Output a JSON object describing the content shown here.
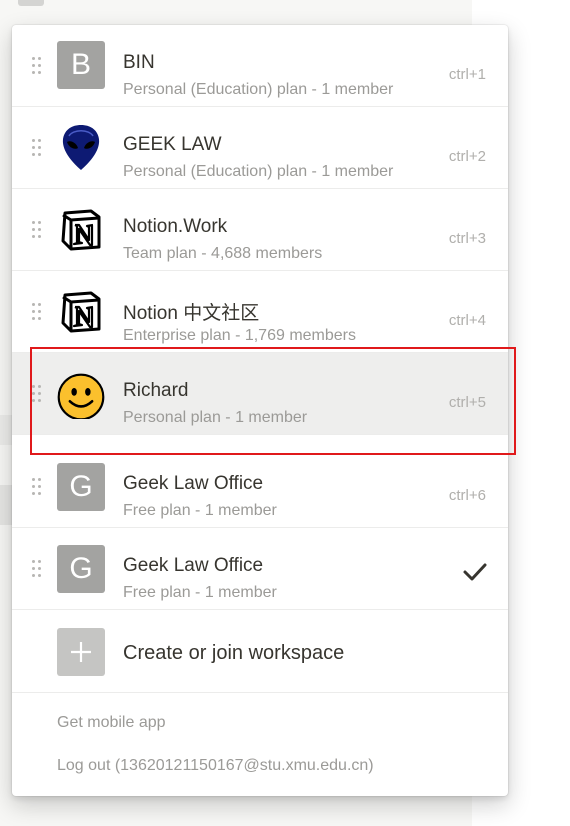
{
  "workspaces": [
    {
      "avatar_letter": "B",
      "avatar_icon": "letter-avatar",
      "name": "BIN",
      "plan": "Personal (Education) plan - 1 member",
      "shortcut": "ctrl+1"
    },
    {
      "avatar_letter": "",
      "avatar_icon": "alien-icon",
      "name": "GEEK LAW",
      "plan": "Personal (Education) plan - 1 member",
      "shortcut": "ctrl+2"
    },
    {
      "avatar_letter": "",
      "avatar_icon": "notion-logo-icon",
      "name": "Notion.Work",
      "plan": "Team plan - 4,688 members",
      "shortcut": "ctrl+3"
    },
    {
      "avatar_letter": "",
      "avatar_icon": "notion-logo-icon",
      "name": "Notion 中文社区",
      "plan": "Enterprise plan - 1,769 members",
      "shortcut": "ctrl+4"
    },
    {
      "avatar_letter": "",
      "avatar_icon": "smiley-face-icon",
      "name": "Richard",
      "plan": "Personal plan - 1 member",
      "shortcut": "ctrl+5"
    },
    {
      "avatar_letter": "G",
      "avatar_icon": "letter-avatar",
      "name": "Geek Law Office",
      "plan": "Free plan - 1 member",
      "shortcut": "ctrl+6"
    },
    {
      "avatar_letter": "G",
      "avatar_icon": "letter-avatar",
      "name": "Geek Law Office",
      "plan": "Free plan - 1 member",
      "shortcut": "",
      "current": true
    }
  ],
  "create_workspace": {
    "label": "Create or join workspace",
    "icon": "plus-icon"
  },
  "footer": {
    "mobile_app": "Get mobile app",
    "logout": "Log out (13620121150167@stu.xmu.edu.cn)"
  },
  "colors": {
    "highlight_border": "#e0191b",
    "hover_row": "#eeeeed",
    "avatar_gray": "#a3a3a1"
  }
}
